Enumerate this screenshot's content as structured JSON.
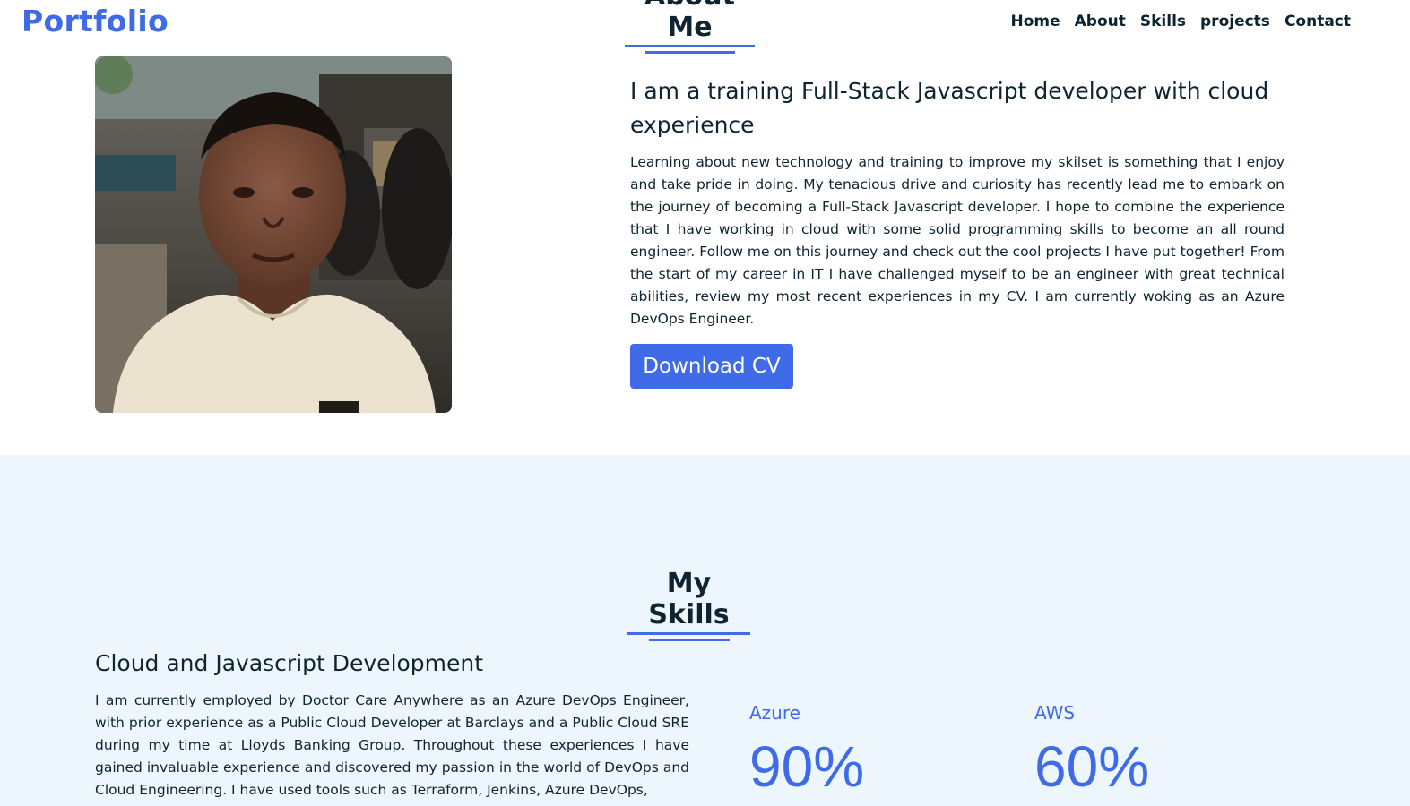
{
  "navbar": {
    "logo": "Portfolio",
    "links": [
      "Home",
      "About",
      "Skills",
      "projects",
      "Contact"
    ]
  },
  "about": {
    "heading": "About Me",
    "title": "I am a training Full-Stack Javascript developer with cloud experience",
    "paragraph": "Learning about new technology and training to improve my skilset is something that I enjoy and take pride in doing. My tenacious drive and curiosity has recently lead me to embark on the journey of becoming a Full-Stack Javascript developer. I hope to combine the experience that I have working in cloud with some solid programming skills to become an all round engineer. Follow me on this journey and check out the cool projects I have put together! From the start of my career in IT I have challenged myself to be an engineer with great technical abilities, review my most recent experiences in my CV. I am currently woking as an Azure DevOps Engineer.",
    "cv_button": "Download CV"
  },
  "skills": {
    "heading": "My Skills",
    "subheading": "Cloud and Javascript Development",
    "paragraph": "I am currently employed by Doctor Care Anywhere as an Azure DevOps Engineer, with prior experience as a Public Cloud Developer at Barclays and a Public Cloud SRE during my time at Lloyds Banking Group. Throughout these experiences I have gained invaluable experience and discovered my passion in the world of DevOps and Cloud Engineering. I have used tools such as Terraform, Jenkins, Azure DevOps,",
    "items": [
      {
        "name": "Azure",
        "percent": "90%"
      },
      {
        "name": "AWS",
        "percent": "60%"
      }
    ]
  },
  "colors": {
    "accent": "#3f6ae8",
    "text": "#0e2431",
    "skills_bg": "#eef6fd"
  }
}
